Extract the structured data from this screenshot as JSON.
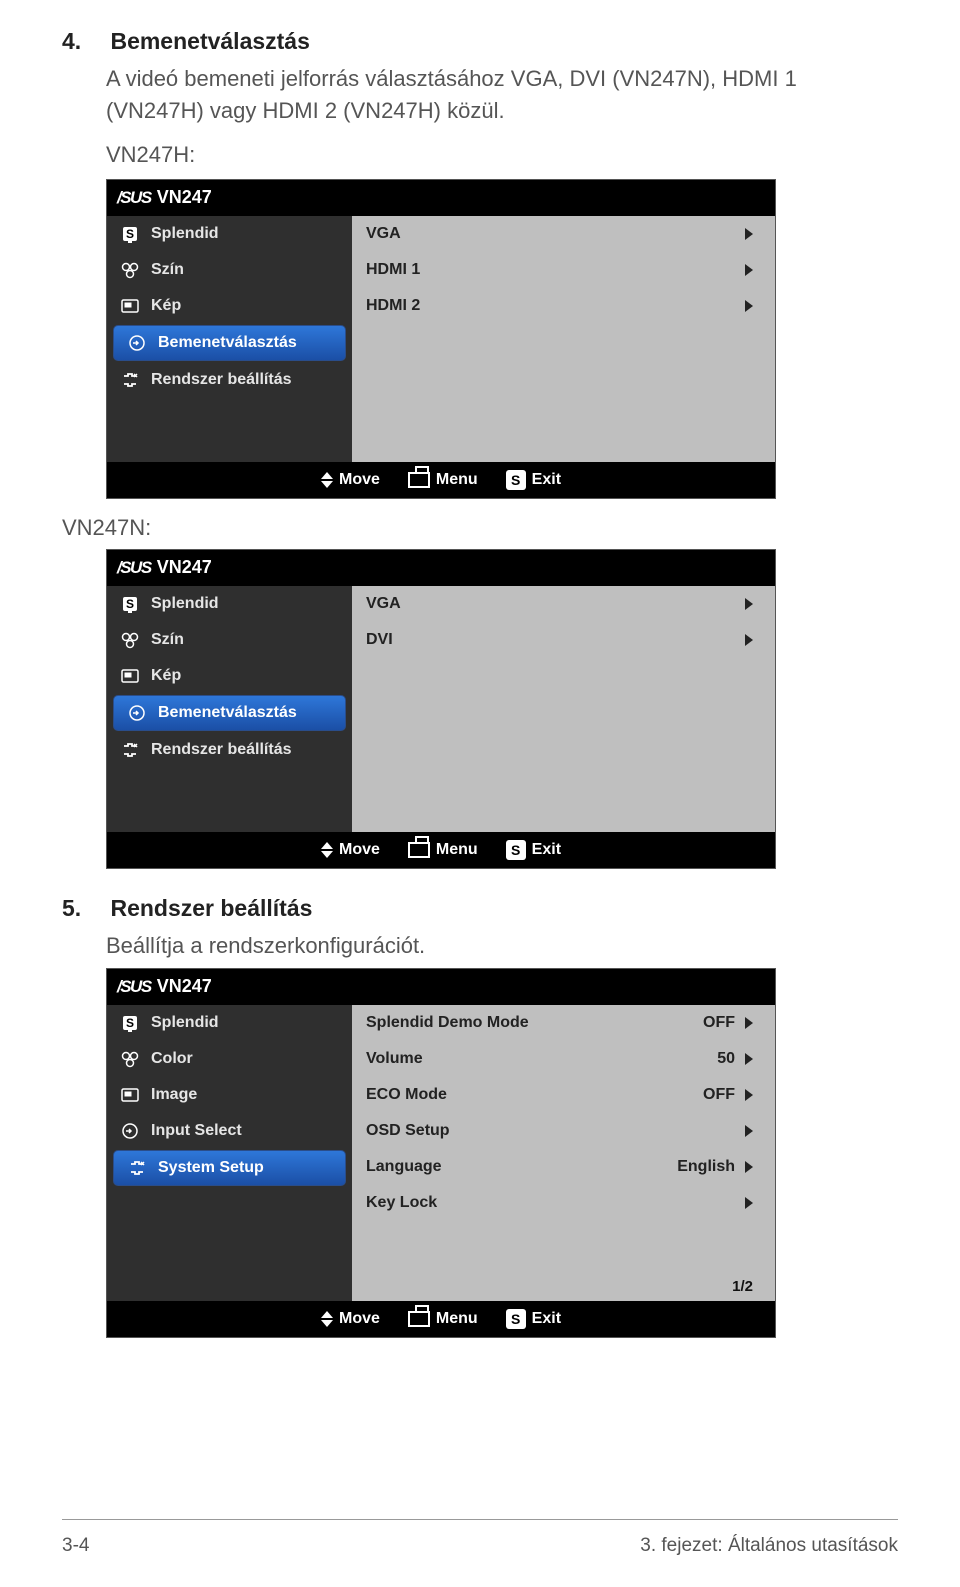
{
  "sections": [
    {
      "num": "4.",
      "title": "Bemenetválasztás",
      "body": "A videó bemeneti jelforrás választásához VGA, DVI (VN247N), HDMI 1 (VN247H) vagy HDMI 2 (VN247H) közül.",
      "model_a": "VN247H:",
      "model_b": "VN247N:"
    },
    {
      "num": "5.",
      "title": "Rendszer beállítás",
      "body": "Beállítja a rendszerkonfigurációt."
    }
  ],
  "osd_common": {
    "brand": "VN247",
    "footer": {
      "move": "Move",
      "menu": "Menu",
      "exit": "Exit"
    }
  },
  "osd1": {
    "left": [
      "Splendid",
      "Szín",
      "Kép",
      "Bemenetválasztás",
      "Rendszer beállítás"
    ],
    "selected": 3,
    "right": [
      "VGA",
      "HDMI 1",
      "HDMI 2"
    ]
  },
  "osd2": {
    "left": [
      "Splendid",
      "Szín",
      "Kép",
      "Bemenetválasztás",
      "Rendszer beállítás"
    ],
    "selected": 3,
    "right": [
      "VGA",
      "DVI"
    ]
  },
  "osd3": {
    "left": [
      "Splendid",
      "Color",
      "Image",
      "Input Select",
      "System Setup"
    ],
    "selected": 4,
    "right": [
      {
        "label": "Splendid Demo Mode",
        "val": "OFF"
      },
      {
        "label": "Volume",
        "val": "50"
      },
      {
        "label": "ECO Mode",
        "val": "OFF"
      },
      {
        "label": "OSD Setup",
        "val": ""
      },
      {
        "label": "Language",
        "val": "English"
      },
      {
        "label": "Key Lock",
        "val": ""
      }
    ],
    "page_indicator": "1/2"
  },
  "footer": {
    "left": "3-4",
    "right": "3. fejezet: Általános utasítások"
  }
}
